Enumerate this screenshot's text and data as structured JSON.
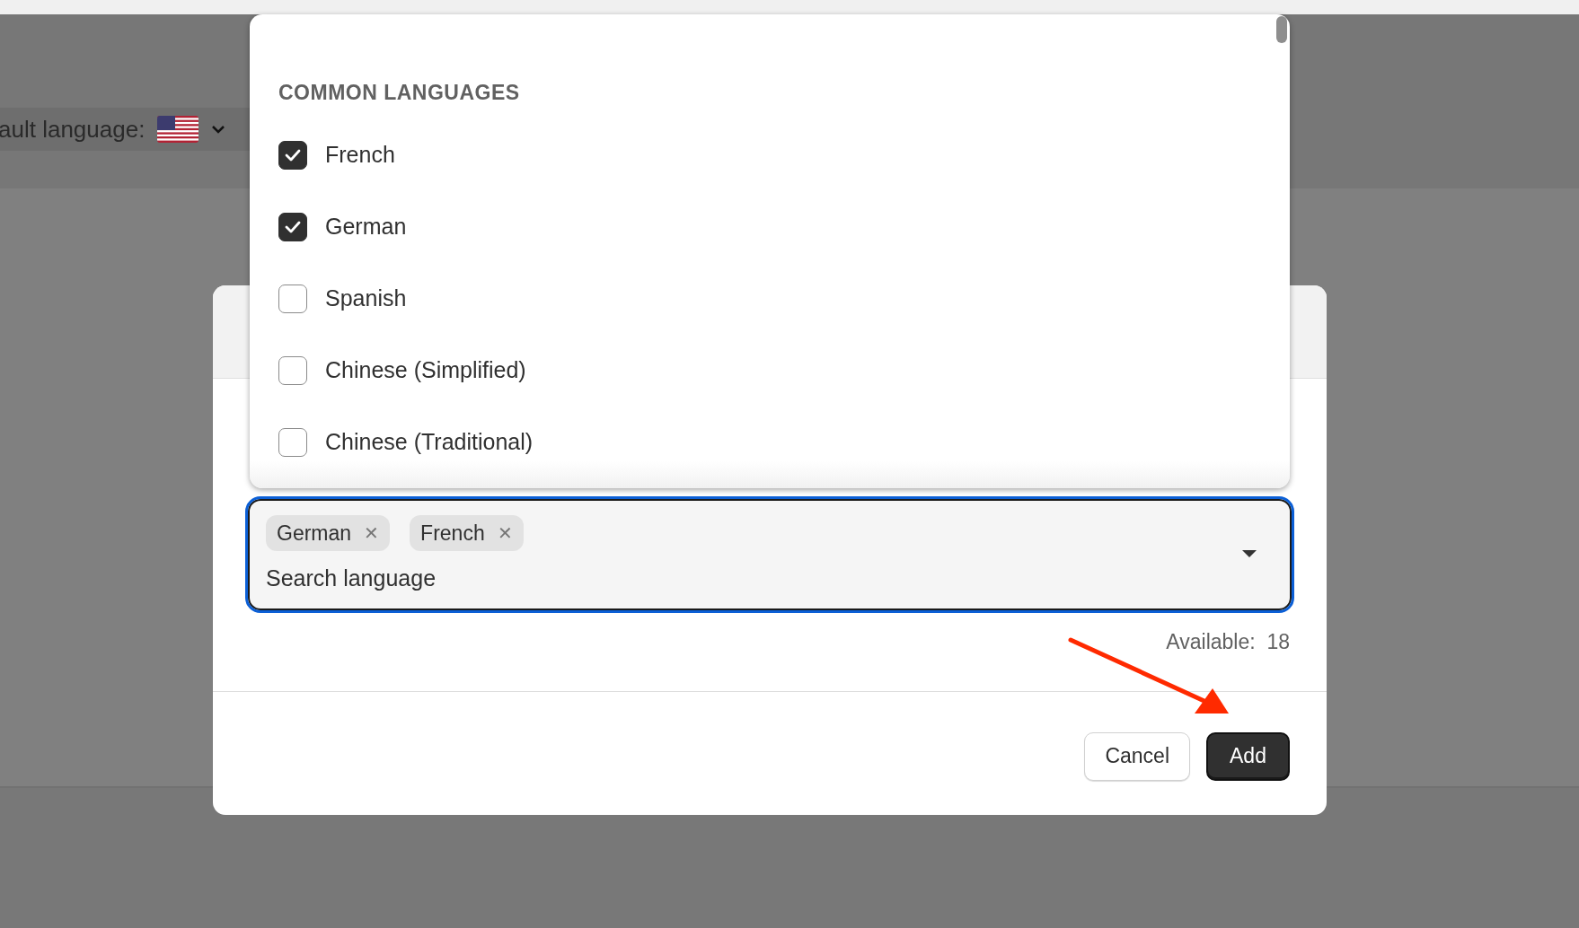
{
  "background": {
    "default_language_label": "ault language:"
  },
  "dropdown": {
    "section_title": "COMMON LANGUAGES",
    "options": [
      {
        "label": "French",
        "checked": true
      },
      {
        "label": "German",
        "checked": true
      },
      {
        "label": "Spanish",
        "checked": false
      },
      {
        "label": "Chinese (Simplified)",
        "checked": false
      },
      {
        "label": "Chinese (Traditional)",
        "checked": false
      }
    ]
  },
  "language_field": {
    "tags": [
      {
        "label": "German",
        "remove": "✕"
      },
      {
        "label": "French",
        "remove": "✕"
      }
    ],
    "placeholder": "Search language"
  },
  "available": {
    "label": "Available:",
    "count": "18"
  },
  "buttons": [
    {
      "label": "Cancel",
      "kind": "secondary"
    },
    {
      "label": "Add",
      "kind": "primary"
    }
  ]
}
